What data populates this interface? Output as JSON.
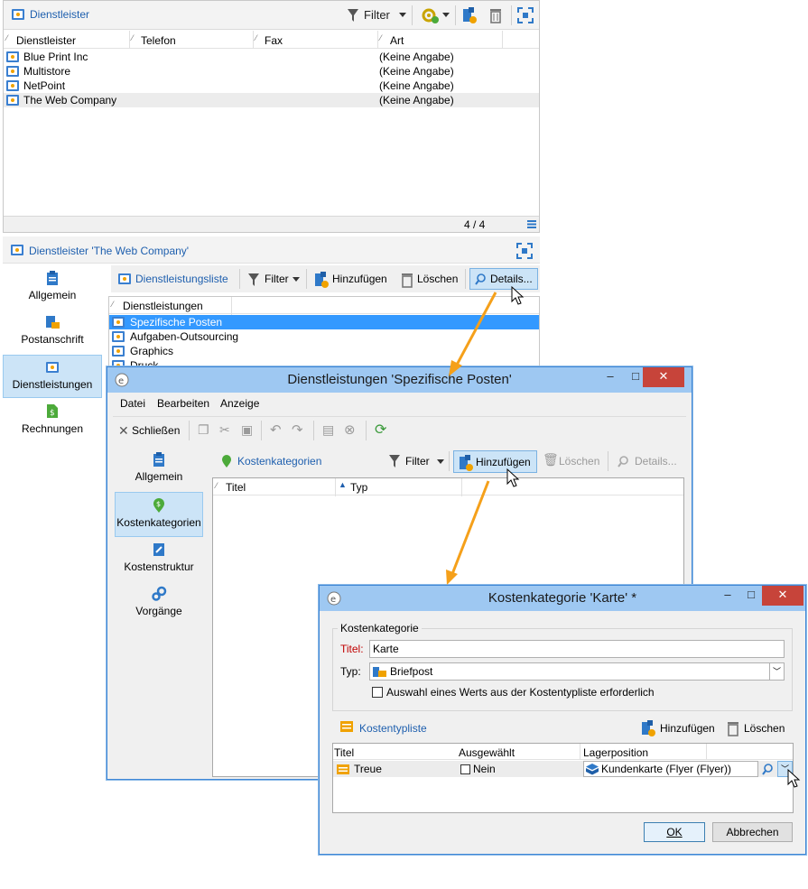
{
  "top_panel": {
    "title": "Dienstleister",
    "filter_label": "Filter",
    "columns": [
      "Dienstleister",
      "Telefon",
      "Fax",
      "Art"
    ],
    "rows": [
      {
        "name": "Blue Print Inc",
        "art": "(Keine Angabe)"
      },
      {
        "name": "Multistore",
        "art": "(Keine Angabe)"
      },
      {
        "name": "NetPoint",
        "art": "(Keine Angabe)"
      },
      {
        "name": "The Web Company",
        "art": "(Keine Angabe)"
      }
    ],
    "count": "4 / 4"
  },
  "detail_panel": {
    "title": "Dienstleister 'The Web Company'",
    "sidebar": [
      "Allgemein",
      "Postanschrift",
      "Dienstleistungen",
      "Rechnungen"
    ],
    "list_title": "Dienstleistungsliste",
    "filter_label": "Filter",
    "add_label": "Hinzufügen",
    "delete_label": "Löschen",
    "details_label": "Details...",
    "column": "Dienstleistungen",
    "rows": [
      "Spezifische Posten",
      "Aufgaben-Outsourcing",
      "Graphics",
      "Druck"
    ]
  },
  "dialog1": {
    "title": "Dienstleistungen 'Spezifische Posten'",
    "menu": [
      "Datei",
      "Bearbeiten",
      "Anzeige"
    ],
    "close_label": "Schließen",
    "sidebar": [
      "Allgemein",
      "Kostenkategorien",
      "Kostenstruktur",
      "Vorgänge"
    ],
    "list_title": "Kostenkategorien",
    "filter_label": "Filter",
    "add_label": "Hinzufügen",
    "delete_label": "Löschen",
    "details_label": "Details...",
    "columns": [
      "Titel",
      "Typ"
    ]
  },
  "dialog2": {
    "title": "Kostenkategorie 'Karte' *",
    "group_label": "Kostenkategorie",
    "title_label": "Titel:",
    "title_value": "Karte",
    "type_label": "Typ:",
    "type_value": "Briefpost",
    "checkbox_label": "Auswahl eines Werts aus der Kostentypliste erforderlich",
    "list_title": "Kostentypliste",
    "add_label": "Hinzufügen",
    "delete_label": "Löschen",
    "columns": [
      "Titel",
      "Ausgewählt",
      "Lagerposition"
    ],
    "row": {
      "titel": "Treue",
      "selected": "Nein",
      "position": "Kundenkarte (Flyer (Flyer))"
    },
    "ok_label": "OK",
    "cancel_label": "Abbrechen"
  },
  "colors": {
    "accent": "#1e5fae",
    "selection": "#3399ff",
    "arrow": "#f5a01a",
    "title_bar": "#9ec8f2",
    "close": "#c7443a"
  }
}
